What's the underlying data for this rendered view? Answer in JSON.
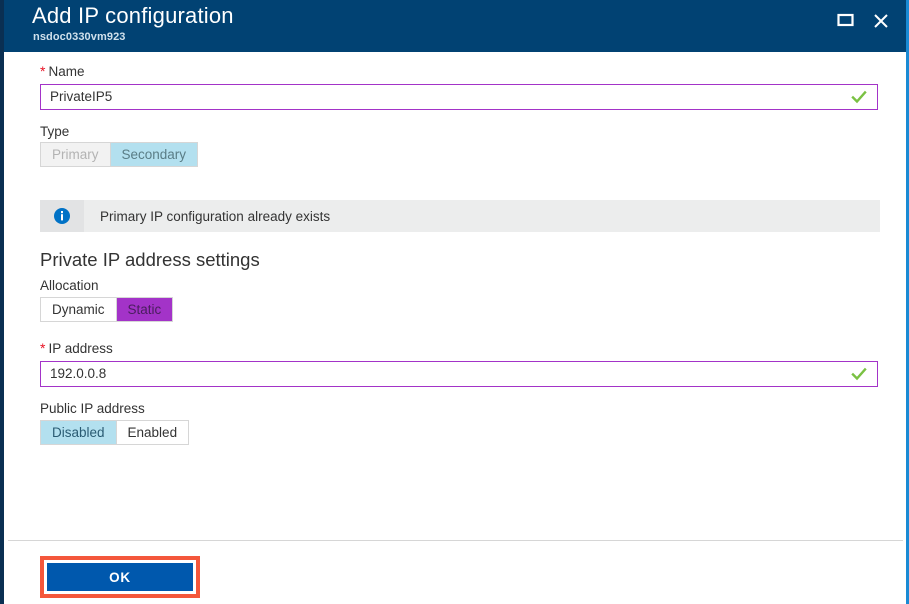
{
  "window": {
    "title": "Add IP configuration",
    "subtitle": "nsdoc0330vm923",
    "restore_icon": "restore-icon",
    "close_icon": "close-icon",
    "header_color": "#014273"
  },
  "form": {
    "name": {
      "label": "Name",
      "required": true,
      "value": "PrivateIP5",
      "valid_icon": "checkmark-icon"
    },
    "type": {
      "label": "Type",
      "options": [
        "Primary",
        "Secondary"
      ],
      "selected": "Secondary",
      "disabled": true
    },
    "info": {
      "icon": "info-circle-icon",
      "message": "Primary IP configuration already exists"
    },
    "section": {
      "heading": "Private IP address settings"
    },
    "allocation": {
      "label": "Allocation",
      "options": [
        "Dynamic",
        "Static"
      ],
      "selected": "Static"
    },
    "ip_address": {
      "label": "IP address",
      "required": true,
      "value": "192.0.0.8",
      "valid_icon": "checkmark-icon"
    },
    "public_ip": {
      "label": "Public IP address",
      "options": [
        "Disabled",
        "Enabled"
      ],
      "selected": "Disabled"
    }
  },
  "footer": {
    "ok_label": "OK",
    "ok_color": "#0058ad",
    "highlight_color": "#f4573b"
  }
}
